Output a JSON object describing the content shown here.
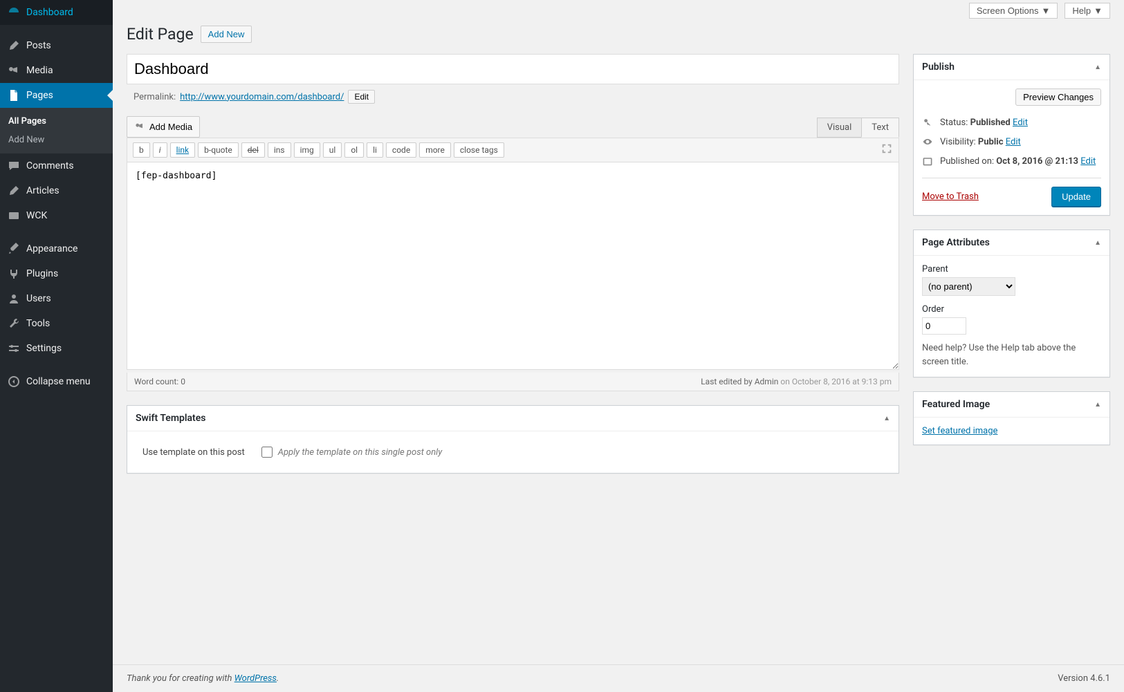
{
  "topButtons": {
    "screenOptions": "Screen Options",
    "help": "Help"
  },
  "sidebar": {
    "items": [
      {
        "label": "Dashboard",
        "icon": "dashboard"
      },
      {
        "label": "Posts",
        "icon": "pin"
      },
      {
        "label": "Media",
        "icon": "media"
      },
      {
        "label": "Pages",
        "icon": "page",
        "active": true
      },
      {
        "label": "Comments",
        "icon": "comment"
      },
      {
        "label": "Articles",
        "icon": "pin"
      },
      {
        "label": "WCK",
        "icon": "wck"
      },
      {
        "label": "Appearance",
        "icon": "brush"
      },
      {
        "label": "Plugins",
        "icon": "plug"
      },
      {
        "label": "Users",
        "icon": "user"
      },
      {
        "label": "Tools",
        "icon": "wrench"
      },
      {
        "label": "Settings",
        "icon": "sliders"
      },
      {
        "label": "Collapse menu",
        "icon": "collapse"
      }
    ],
    "submenu": {
      "allPages": "All Pages",
      "addNew": "Add New"
    }
  },
  "heading": {
    "title": "Edit Page",
    "addNew": "Add New"
  },
  "titleField": {
    "value": "Dashboard"
  },
  "permalink": {
    "label": "Permalink:",
    "url": "http://www.yourdomain.com/dashboard/",
    "editBtn": "Edit"
  },
  "editor": {
    "addMedia": "Add Media",
    "tabs": {
      "visual": "Visual",
      "text": "Text"
    },
    "quicktags": [
      "b",
      "i",
      "link",
      "b-quote",
      "del",
      "ins",
      "img",
      "ul",
      "ol",
      "li",
      "code",
      "more",
      "close tags"
    ],
    "content": "[fep-dashboard]",
    "wordCountLabel": "Word count:",
    "wordCount": "0",
    "lastEditedPrefix": "Last edited by Admin",
    "lastEditedSuffix": "on October 8, 2016 at 9:13 pm"
  },
  "swift": {
    "title": "Swift Templates",
    "useLabel": "Use template on this post",
    "applyLabel": "Apply the template on this single post only"
  },
  "publish": {
    "title": "Publish",
    "preview": "Preview Changes",
    "statusLabel": "Status:",
    "statusValue": "Published",
    "visibilityLabel": "Visibility:",
    "visibilityValue": "Public",
    "publishedLabel": "Published on:",
    "publishedValue": "Oct 8, 2016 @ 21:13",
    "edit": "Edit",
    "trash": "Move to Trash",
    "update": "Update"
  },
  "pageAttributes": {
    "title": "Page Attributes",
    "parentLabel": "Parent",
    "parentValue": "(no parent)",
    "orderLabel": "Order",
    "orderValue": "0",
    "helpText": "Need help? Use the Help tab above the screen title."
  },
  "featuredImage": {
    "title": "Featured Image",
    "link": "Set featured image"
  },
  "footer": {
    "thankYou": "Thank you for creating with ",
    "wpLink": "WordPress",
    "version": "Version 4.6.1"
  }
}
